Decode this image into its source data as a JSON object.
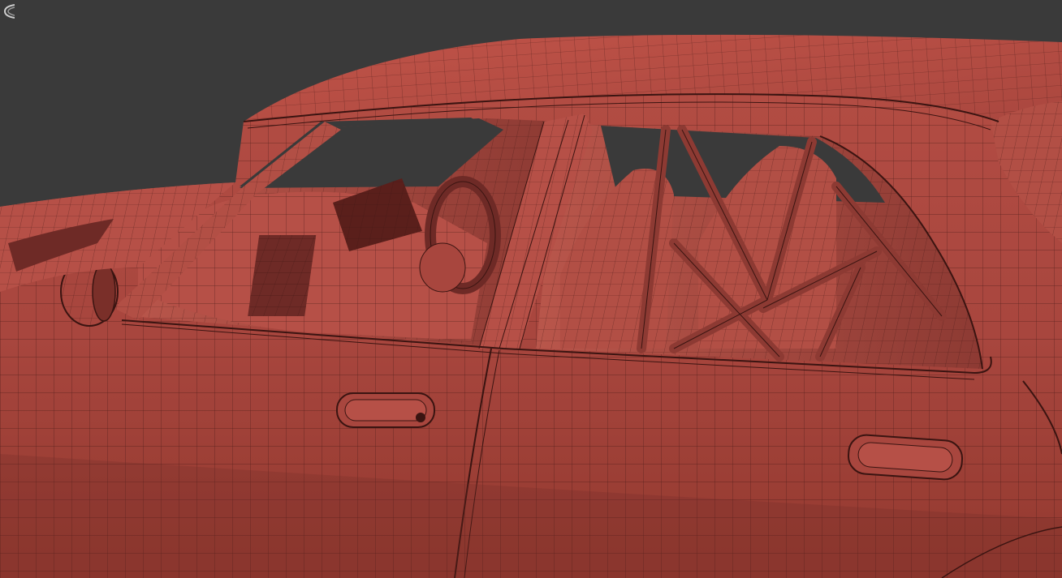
{
  "viewport": {
    "background": "#3a3a3a",
    "mesh_fill": "#a8463e",
    "mesh_highlight": "#c4594d",
    "mesh_shadow": "#6e2a26",
    "wire_color": "#3a1411",
    "glass_color": "#3a3a3a"
  },
  "icons": {
    "view_gizmo": "view-gizmo-icon"
  }
}
